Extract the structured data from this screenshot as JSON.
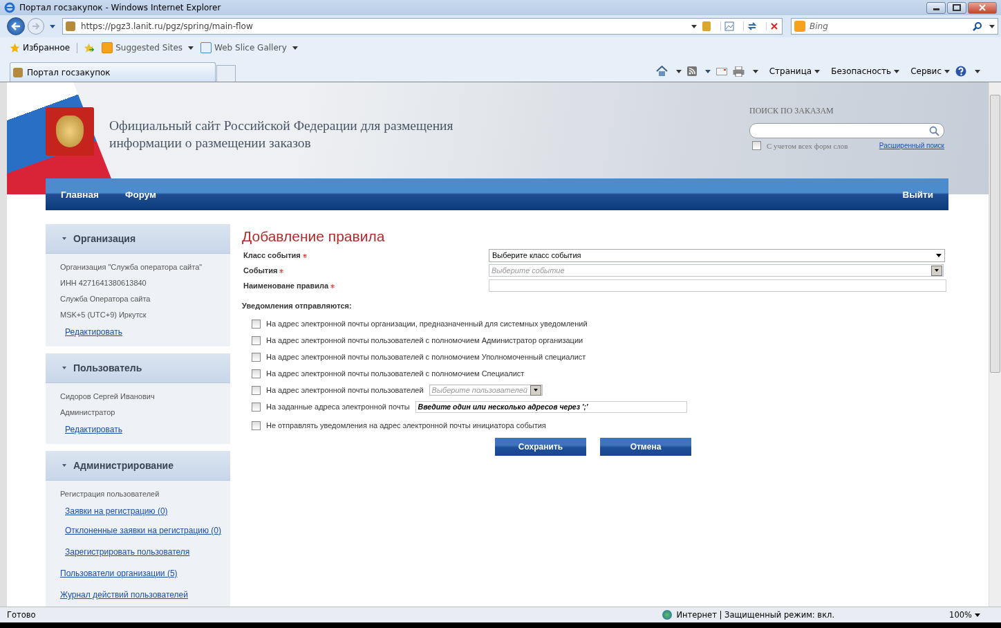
{
  "window": {
    "title": "Портал госзакупок - Windows Internet Explorer"
  },
  "address": {
    "value": "https://pgz3.lanit.ru/pgz/spring/main-flow"
  },
  "browser_search": {
    "placeholder": "Bing"
  },
  "favorites_bar": {
    "favorites": "Избранное",
    "links": [
      "Suggested Sites",
      "Web Slice Gallery"
    ]
  },
  "tabs": [
    {
      "label": "Портал госзакупок",
      "selected": true
    }
  ],
  "command_bar": [
    "Страница",
    "Безопасность",
    "Сервис"
  ],
  "site": {
    "title": "Официальный сайт Российской Федерации для размещения информации о размещении заказов",
    "search_label": "ПОИСК ПО ЗАКАЗАМ",
    "word_forms": {
      "label": "С учетом всех форм слов",
      "checked": false
    },
    "advanced_search": "Расширенный поиск"
  },
  "nav": {
    "left": [
      "Главная",
      "Форум"
    ],
    "right": "Выйти"
  },
  "sidebar": [
    {
      "title": "Организация",
      "items": [
        {
          "kind": "text",
          "label": "Организация \"Служба оператора сайта\""
        },
        {
          "kind": "text",
          "label": "ИНН 4271641380613840"
        },
        {
          "kind": "text",
          "label": "Служба Оператора сайта"
        },
        {
          "kind": "text",
          "label": "MSK+5 (UTC+9) Иркутск"
        },
        {
          "kind": "sublink",
          "label": "Редактировать"
        }
      ]
    },
    {
      "title": "Пользователь",
      "items": [
        {
          "kind": "text",
          "label": "Сидоров Сергей Иванович"
        },
        {
          "kind": "text",
          "label": "Администратор"
        },
        {
          "kind": "sublink",
          "label": "Редактировать"
        }
      ]
    },
    {
      "title": "Администрирование",
      "items": [
        {
          "kind": "text",
          "label": "Регистрация пользователей"
        },
        {
          "kind": "sublink",
          "label": "Заявки на регистрацию (0)"
        },
        {
          "kind": "sublink",
          "label": "Отклоненные заявки на регистрацию (0)"
        },
        {
          "kind": "sublink",
          "label": "Зарегистрировать пользователя"
        },
        {
          "kind": "link",
          "label": "Пользователи организации (5)"
        },
        {
          "kind": "link",
          "label": "Журнал действий пользователей"
        }
      ]
    }
  ],
  "form": {
    "title": "Добавление правила",
    "fields": [
      {
        "label": "Класс события",
        "required": true,
        "kind": "select",
        "value": "Выберите класс события"
      },
      {
        "label": "События",
        "required": true,
        "kind": "combo",
        "placeholder": "Выберите событие"
      },
      {
        "label": "Наименоване правила",
        "required": true,
        "kind": "text"
      }
    ],
    "notify_label": "Уведомления отправляются:",
    "options": [
      {
        "label": "На адрес электронной почты организации, предназначенный для системных уведомлений",
        "checked": false
      },
      {
        "label": "На адрес электронной почты пользователей с полномочием Администратор организации",
        "checked": false
      },
      {
        "label": "На адрес электронной почты пользователей с полномочием Уполномоченный специалист",
        "checked": false
      },
      {
        "label": "На адрес электронной почты пользователей с полномочием Специалист",
        "checked": false
      },
      {
        "label": "На адрес электронной почты пользователей",
        "checked": false,
        "kind": "users",
        "placeholder": "Выберите пользователей"
      },
      {
        "label": "На заданные адреса электронной почты",
        "checked": false,
        "kind": "emails",
        "value": "Введите один или несколько адресов через ';'"
      },
      {
        "label": "Не отправлять уведомления на адрес электронной почты инициатора события",
        "checked": false,
        "kind": "gap"
      }
    ],
    "buttons": [
      "Сохранить",
      "Отмена"
    ]
  },
  "status_bar": {
    "text": "Готово",
    "zone": "Интернет | Защищенный режим: вкл.",
    "zoom": "100%"
  }
}
